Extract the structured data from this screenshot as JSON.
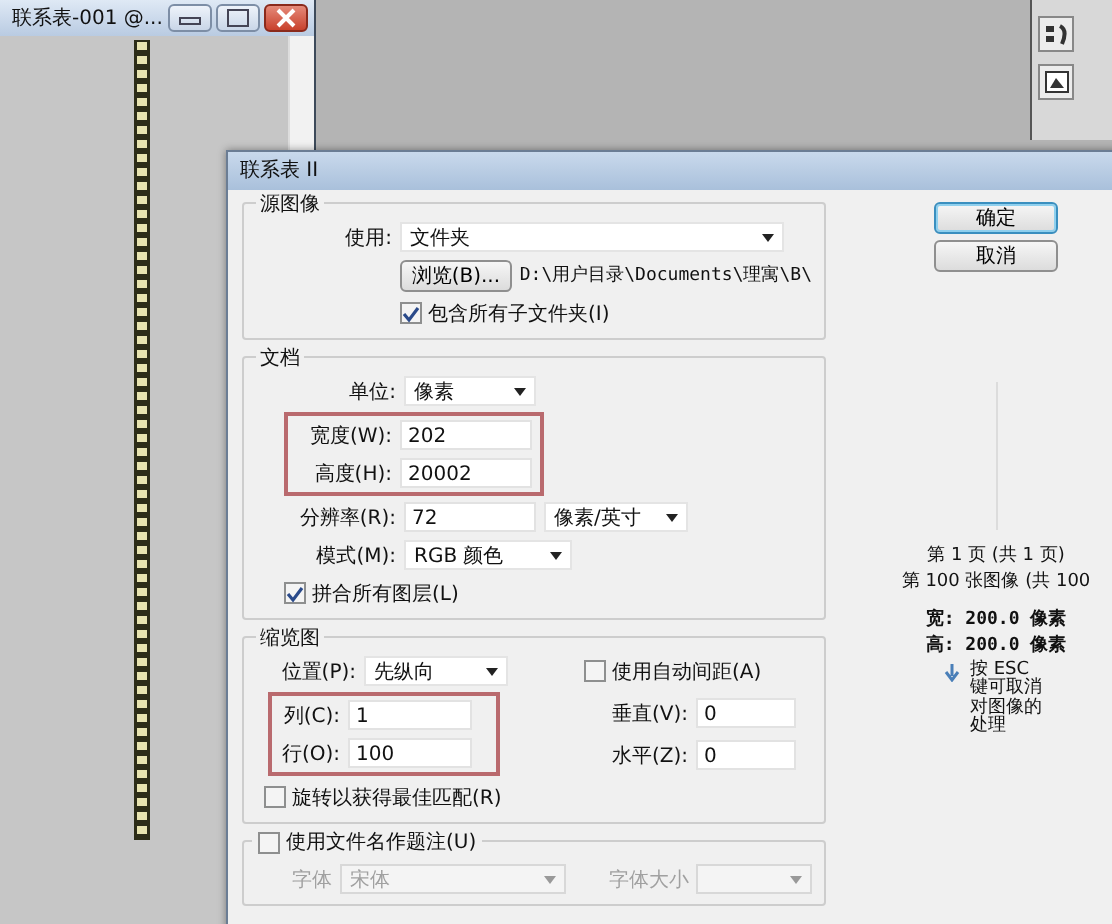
{
  "document_window": {
    "title": "联系表-001 @..."
  },
  "dialog": {
    "title": "联系表 II",
    "source": {
      "legend": "源图像",
      "use": {
        "label": "使用:",
        "value": "文件夹"
      },
      "browse_button": "浏览(B)...",
      "path": "D:\\用户目录\\Documents\\理寓\\B\\",
      "include_subfolders": {
        "label": "包含所有子文件夹(I)",
        "checked": true
      }
    },
    "document": {
      "legend": "文档",
      "unit": {
        "label": "单位:",
        "value": "像素"
      },
      "size": {
        "highlighted": true,
        "fields": [
          {
            "label": "宽度(W):",
            "value": "202"
          },
          {
            "label": "高度(H):",
            "value": "20002"
          }
        ]
      },
      "resolution": {
        "label": "分辨率(R):",
        "value": "72",
        "unit": "像素/英寸"
      },
      "mode": {
        "label": "模式(M):",
        "value": "RGB 颜色"
      },
      "flatten": {
        "label": "拼合所有图层(L)",
        "checked": true
      }
    },
    "thumbnails": {
      "legend": "缩览图",
      "place": {
        "label": "位置(P):",
        "value": "先纵向"
      },
      "grid": {
        "highlighted": true,
        "fields": [
          {
            "label": "列(C):",
            "value": "1"
          },
          {
            "label": "行(O):",
            "value": "100"
          }
        ]
      },
      "auto_spacing": {
        "label": "使用自动间距(A)",
        "checked": false
      },
      "spacing": [
        {
          "label": "垂直(V):",
          "value": "0"
        },
        {
          "label": "水平(Z):",
          "value": "0"
        }
      ],
      "rotate": {
        "label": "旋转以获得最佳匹配(R)",
        "checked": false
      }
    },
    "caption": {
      "use_filename": {
        "label": "使用文件名作题注(U)",
        "checked": false
      },
      "font": {
        "label": "字体",
        "value": "宋体",
        "disabled": true
      },
      "font_size": {
        "label": "字体大小",
        "disabled": true
      }
    },
    "buttons": [
      {
        "label": "确定",
        "default": true
      },
      {
        "label": "取消",
        "default": false
      }
    ],
    "preview": {
      "page": "第 1 页 (共 1 页)",
      "image": "第 100 张图像 (共 100",
      "width": "宽: 200.0 像素",
      "height": "高: 200.0 像素",
      "hint": "按 ESC 键可取消对图像的处理"
    }
  }
}
